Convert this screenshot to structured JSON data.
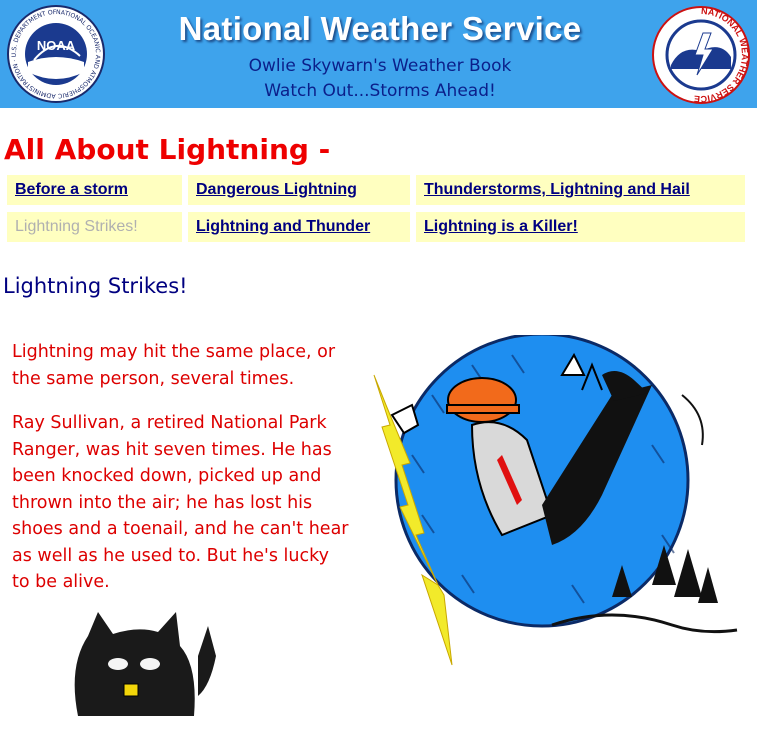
{
  "banner": {
    "title": "National Weather Service",
    "subtitle_line1": "Owlie Skywarn's Weather Book",
    "subtitle_line2": "Watch Out...Storms Ahead!",
    "noaa_logo_text": "NOAA",
    "noaa_ring_text": "NATIONAL OCEANIC AND ATMOSPHERIC ADMINISTRATION · U.S. DEPARTMENT OF COMMERCE",
    "nws_ring_text": "NATIONAL WEATHER SERVICE"
  },
  "page_title": "All About Lightning -",
  "nav": {
    "links": [
      {
        "label": "Before a storm",
        "current": false
      },
      {
        "label": "Dangerous Lightning",
        "current": false
      },
      {
        "label": "Thunderstorms, Lightning and Hail",
        "current": false
      },
      {
        "label": "Lightning Strikes!",
        "current": true
      },
      {
        "label": "Lightning and Thunder",
        "current": false
      },
      {
        "label": "Lightning is a Killer!",
        "current": false
      }
    ]
  },
  "section_title": "Lightning Strikes!",
  "story": {
    "paragraph1": "Lightning may hit the same place, or the same person, several times.",
    "paragraph2": "Ray Sullivan, a retired National Park Ranger, was hit seven times. He has been knocked down, picked up and thrown into the air; he has lost his shoes and a toenail, and he can't hear as well as he used to. But he's lucky to be alive."
  },
  "colors": {
    "banner_bg": "#3ea3ec",
    "banner_text": "#ffffff",
    "banner_subtitle": "#0b1f8a",
    "page_title": "#ee0000",
    "nav_bg": "#ffffc0",
    "nav_link": "#000080",
    "nav_current": "#b0b0b0",
    "section_title": "#000080",
    "story_text": "#dd0000"
  }
}
